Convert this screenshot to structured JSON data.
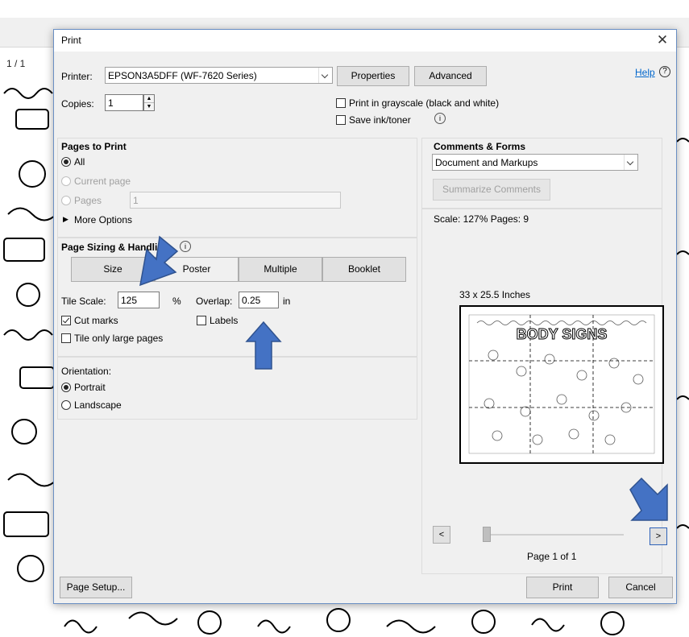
{
  "background": {
    "page_indicator": "1   / 1"
  },
  "dialog": {
    "title": "Print",
    "help_label": "Help",
    "printer": {
      "label": "Printer:",
      "value": "EPSON3A5DFF (WF-7620 Series)",
      "properties_label": "Properties",
      "advanced_label": "Advanced"
    },
    "copies": {
      "label": "Copies:",
      "value": "1"
    },
    "grayscale_label": "Print in grayscale (black and white)",
    "grayscale_checked": false,
    "save_ink_label": "Save ink/toner",
    "save_ink_checked": false,
    "pages_to_print": {
      "heading": "Pages to Print",
      "all_label": "All",
      "current_page_label": "Current page",
      "pages_label": "Pages",
      "pages_value": "1",
      "more_options_label": "More Options",
      "selected": "All"
    },
    "page_sizing": {
      "heading": "Page Sizing & Handling",
      "tabs": [
        "Size",
        "Poster",
        "Multiple",
        "Booklet"
      ],
      "active_tab": "Poster",
      "tile_scale_label": "Tile Scale:",
      "tile_scale_value": "125",
      "tile_scale_unit": "%",
      "overlap_label": "Overlap:",
      "overlap_value": "0.25",
      "overlap_unit": "in",
      "cut_marks_label": "Cut marks",
      "cut_marks_checked": true,
      "labels_label": "Labels",
      "labels_checked": false,
      "tile_large_label": "Tile only large pages",
      "tile_large_checked": false
    },
    "orientation": {
      "label": "Orientation:",
      "portrait_label": "Portrait",
      "landscape_label": "Landscape",
      "selected": "Portrait"
    },
    "comments_forms": {
      "heading": "Comments & Forms",
      "value": "Document and Markups",
      "summarize_label": "Summarize Comments"
    },
    "preview": {
      "scale_text": "Scale: 127% Pages: 9",
      "size_text": "33 x 25.5 Inches",
      "poster_title": "BODY SIGNS",
      "page_text": "Page 1 of 1",
      "prev_label": "<",
      "next_label": ">"
    },
    "page_setup_label": "Page Setup...",
    "print_label": "Print",
    "cancel_label": "Cancel"
  },
  "colors": {
    "accent": "#2e62b8",
    "arrow": "#4472c4",
    "dialog_bg": "#f0f0f0",
    "link": "#0066cc"
  },
  "icons": [
    "info-icon",
    "close-icon",
    "chevron-down-icon",
    "spin-up-icon",
    "spin-down-icon",
    "triangle-right-icon",
    "arrow-down-icon",
    "arrow-up-icon"
  ]
}
